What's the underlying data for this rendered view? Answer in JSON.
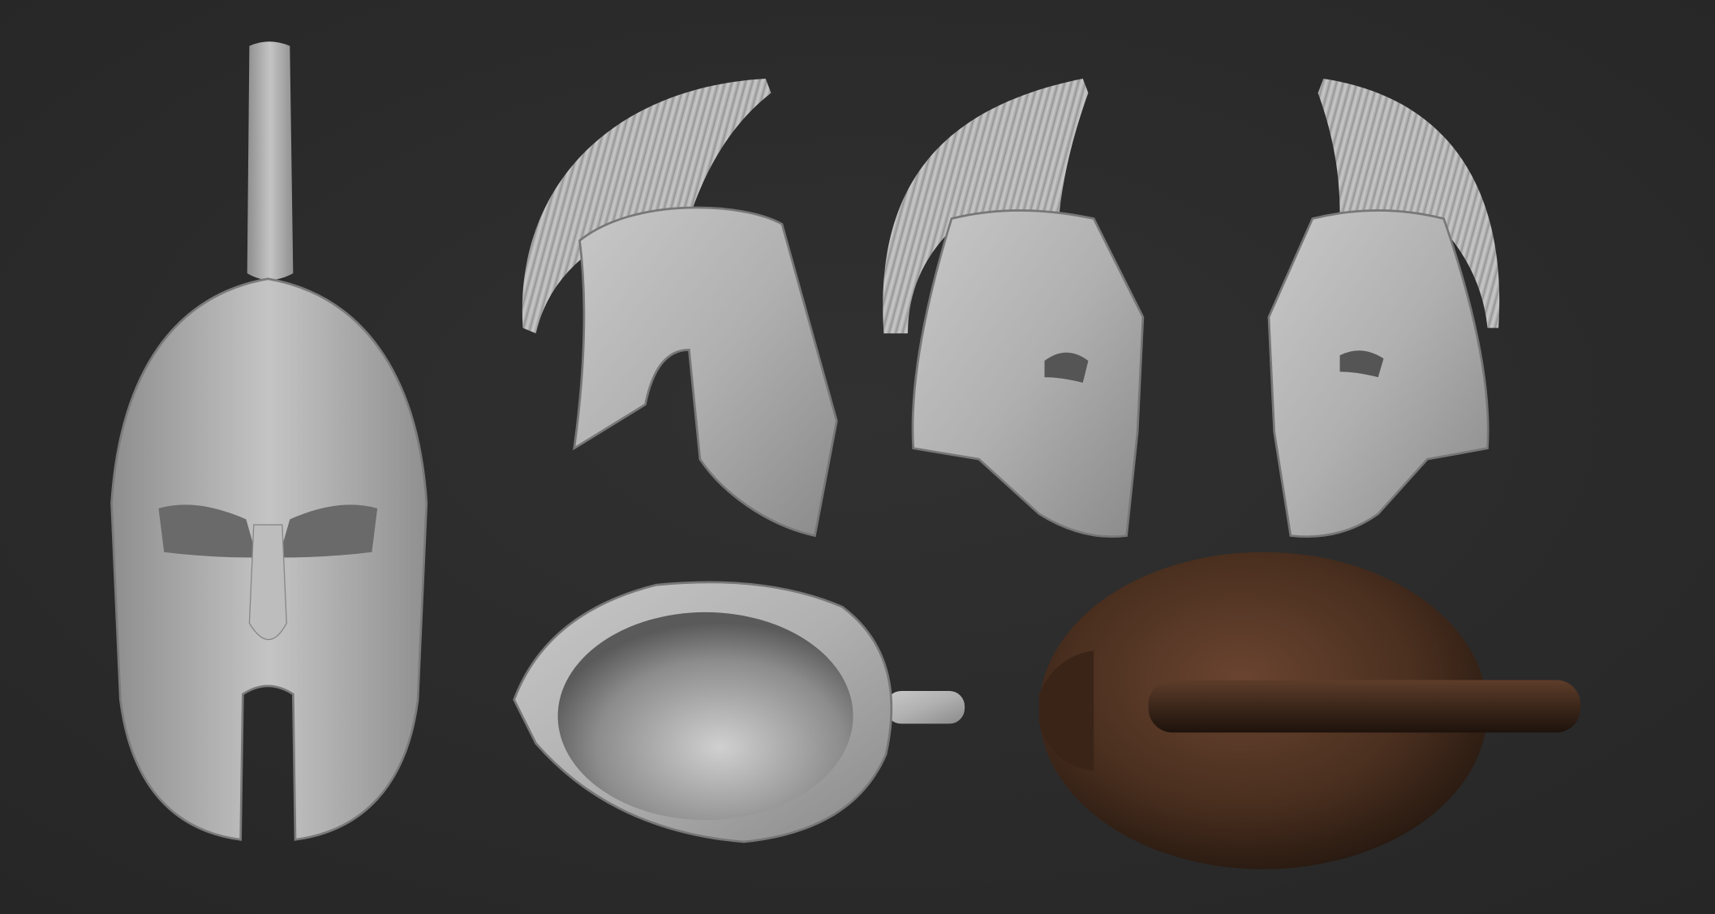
{
  "scene": {
    "background_color": "#2b2b2b",
    "clay_color": "#b4b4b4",
    "textured_color": "#4a2f1f",
    "views": [
      {
        "name": "front-view",
        "material": "clay"
      },
      {
        "name": "side-view-left",
        "material": "clay"
      },
      {
        "name": "three-quarter-view",
        "material": "clay"
      },
      {
        "name": "three-quarter-view-mirrored",
        "material": "clay"
      },
      {
        "name": "bottom-view",
        "material": "clay"
      },
      {
        "name": "textured-bottom-view",
        "material": "textured"
      }
    ]
  }
}
